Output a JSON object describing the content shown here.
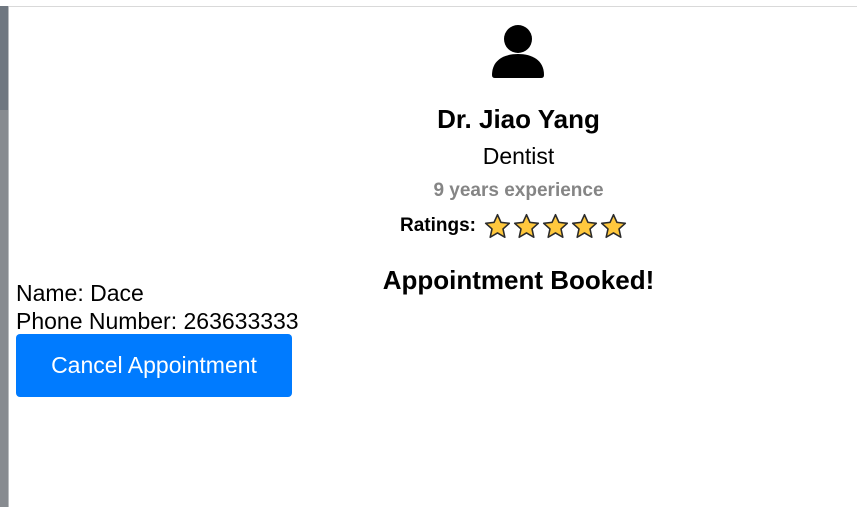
{
  "doctor": {
    "name": "Dr. Jiao Yang",
    "specialty": "Dentist",
    "experience": "9 years experience",
    "ratings_label": "Ratings:",
    "rating": 5,
    "rating_max": 5,
    "avatar_icon": "user-icon",
    "star_icon": "star-icon",
    "star_color": "#ffc83d"
  },
  "booking": {
    "status_heading": "Appointment Booked!",
    "name_line": "Name: Dace",
    "phone_line": "Phone Number: 263633333",
    "cancel_label": "Cancel Appointment",
    "button_color": "#007bff"
  }
}
